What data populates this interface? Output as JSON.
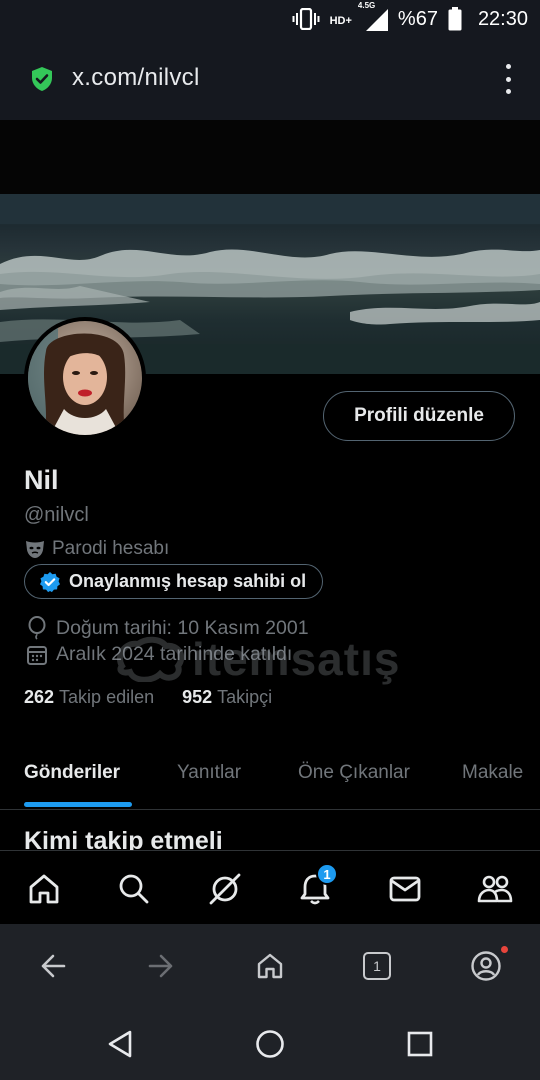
{
  "status_bar": {
    "network": "HD+",
    "network_gen": "4.5G",
    "battery": "%67",
    "time": "22:30"
  },
  "browser": {
    "url": "x.com/nilvcl",
    "tab_count": "1",
    "icons": [
      "back-icon",
      "forward-icon",
      "home-icon",
      "tabs-icon",
      "account-icon"
    ]
  },
  "profile": {
    "name": "Nil",
    "handle": "@nilvcl",
    "parody_label": "Parodi hesabı",
    "verify_button": "Onaylanmış hesap sahibi ol",
    "edit_button": "Profili düzenle",
    "birthday": "Doğum tarihi: 10 Kasım 2001",
    "joined": "Aralık 2024 tarihinde katıldı",
    "following_count": "262",
    "following_label": "Takip edilen",
    "followers_count": "952",
    "followers_label": "Takipçi"
  },
  "tabs": [
    {
      "label": "Gönderiler",
      "active": true
    },
    {
      "label": "Yanıtlar",
      "active": false
    },
    {
      "label": "Öne Çıkanlar",
      "active": false
    },
    {
      "label": "Makale",
      "active": false
    }
  ],
  "who_to_follow": "Kimi takip etmeli",
  "bottom_nav": {
    "items": [
      "home-icon",
      "search-icon",
      "grok-icon",
      "notifications-icon",
      "messages-icon",
      "communities-icon"
    ],
    "notification_badge": "1"
  },
  "watermark": {
    "text": "itemsatış"
  },
  "colors": {
    "accent": "#1d9bf0",
    "background": "#000000",
    "secondary_text": "#71767b",
    "browser_chrome": "#15181f",
    "lock_green": "#34c759"
  }
}
